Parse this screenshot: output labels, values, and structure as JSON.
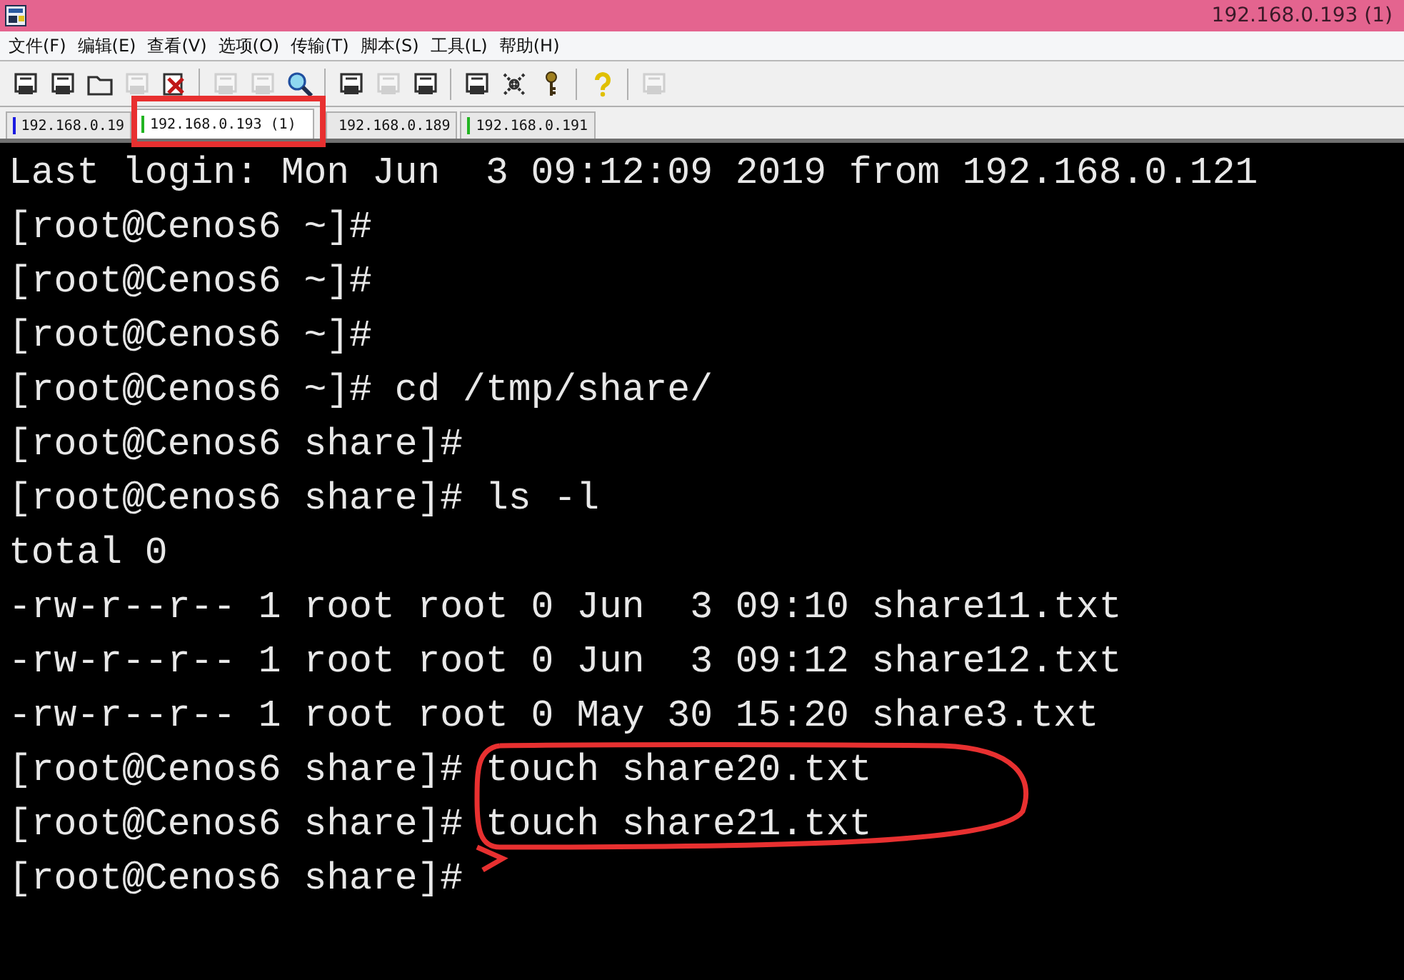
{
  "window": {
    "title": "192.168.0.193 (1)"
  },
  "menu": [
    "文件(F)",
    "编辑(E)",
    "查看(V)",
    "选项(O)",
    "传输(T)",
    "脚本(S)",
    "工具(L)",
    "帮助(H)"
  ],
  "toolbar": [
    [
      {
        "disabled": false
      },
      {
        "disabled": false
      },
      {
        "disabled": false
      },
      {
        "disabled": true
      },
      {
        "disabled": false
      }
    ],
    [
      {
        "disabled": true
      },
      {
        "disabled": true
      },
      {
        "disabled": false
      }
    ],
    [
      {
        "disabled": false
      },
      {
        "disabled": true
      },
      {
        "disabled": false
      }
    ],
    [
      {
        "disabled": false
      },
      {
        "disabled": false
      },
      {
        "disabled": false
      }
    ],
    [
      {
        "disabled": false
      }
    ],
    [
      {
        "disabled": true
      }
    ]
  ],
  "tabs": [
    {
      "label": "192.168.0.19",
      "selected": false,
      "color": "#1a1ae0"
    },
    {
      "label": "192.168.0.193 (1)",
      "selected": true,
      "color": "#22b422"
    },
    {
      "label": "192.168.0.189",
      "selected": false
    },
    {
      "label": "192.168.0.191",
      "selected": false,
      "color": "#22b422"
    }
  ],
  "terminal": {
    "lines": [
      "Last login: Mon Jun  3 09:12:09 2019 from 192.168.0.121",
      "[root@Cenos6 ~]#",
      "[root@Cenos6 ~]#",
      "[root@Cenos6 ~]#",
      "[root@Cenos6 ~]# cd /tmp/share/",
      "[root@Cenos6 share]#",
      "[root@Cenos6 share]# ls -l",
      "total 0",
      "-rw-r--r-- 1 root root 0 Jun  3 09:10 share11.txt",
      "-rw-r--r-- 1 root root 0 Jun  3 09:12 share12.txt",
      "-rw-r--r-- 1 root root 0 May 30 15:20 share3.txt",
      "[root@Cenos6 share]# touch share20.txt",
      "[root@Cenos6 share]# touch share21.txt",
      "[root@Cenos6 share]#"
    ]
  }
}
